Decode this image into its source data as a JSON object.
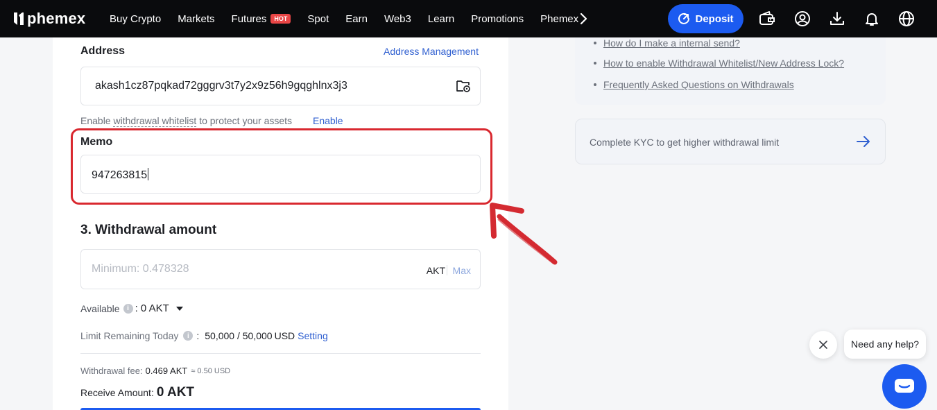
{
  "header": {
    "brand": "phemex",
    "nav": [
      {
        "label": "Buy Crypto"
      },
      {
        "label": "Markets"
      },
      {
        "label": "Futures",
        "badge": "HOT"
      },
      {
        "label": "Spot"
      },
      {
        "label": "Earn"
      },
      {
        "label": "Web3"
      },
      {
        "label": "Learn"
      },
      {
        "label": "Promotions"
      },
      {
        "label": "Phemex"
      }
    ],
    "deposit_label": "Deposit",
    "icons": [
      "wallet-icon",
      "account-icon",
      "download-icon",
      "bell-icon",
      "globe-icon"
    ]
  },
  "form": {
    "address_label": "Address",
    "address_management": "Address Management",
    "address_value": "akash1cz87pqkad72gggrv3t7y2x9z56h9gqghlnx3j3",
    "whitelist_hint_prefix": "Enable ",
    "whitelist_hint_link": "withdrawal whitelist",
    "whitelist_hint_suffix": " to protect your assets",
    "enable_label": "Enable",
    "memo_label": "Memo",
    "memo_value": "947263815",
    "amount_title": "3. Withdrawal amount",
    "amount_placeholder": "Minimum: 0.478328",
    "amount_unit": "AKT",
    "max_label": "Max",
    "available_label": "Available",
    "available_value": ": 0 AKT",
    "limit_label": "Limit Remaining Today",
    "limit_value": "50,000 / 50,000",
    "limit_unit": "USD",
    "setting_label": "Setting",
    "fee_label": "Withdrawal fee:",
    "fee_value": "0.469 AKT",
    "fee_usd": "≈ 0.50 USD",
    "receive_label": "Receive Amount:",
    "receive_value": "0 AKT"
  },
  "sidebar": {
    "faq": [
      "How do I make a internal send?",
      "How to enable Withdrawal Whitelist/New Address Lock?",
      "Frequently Asked Questions on Withdrawals"
    ],
    "kyc_text": "Complete KYC to get higher withdrawal limit"
  },
  "chat": {
    "prompt": "Need any help?"
  },
  "colors": {
    "accent": "#1c5bf0",
    "highlight": "#d9282f",
    "hot_badge": "#e94646"
  }
}
